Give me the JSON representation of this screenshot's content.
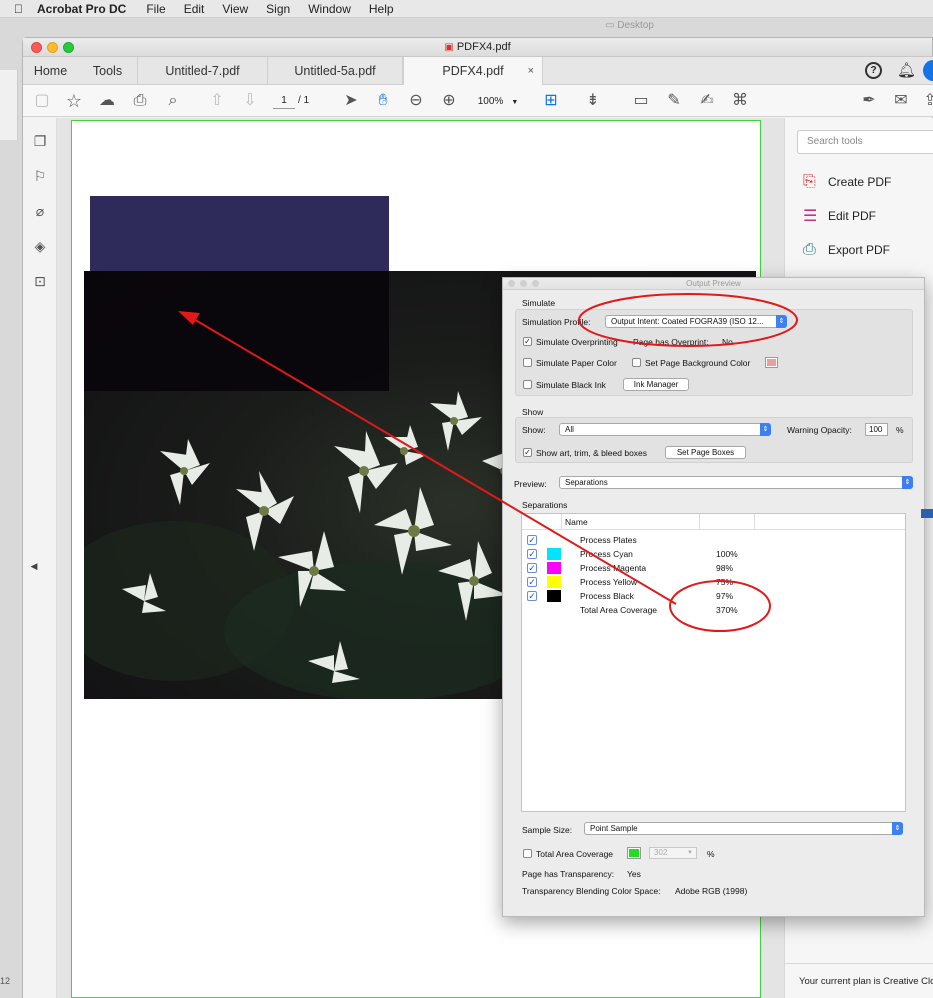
{
  "menubar": {
    "app": "Acrobat Pro DC",
    "items": [
      "File",
      "Edit",
      "View",
      "Sign",
      "Window",
      "Help"
    ],
    "desktop_label": "Desktop"
  },
  "window": {
    "title": "PDFX4.pdf",
    "tabs": [
      {
        "label": "Home"
      },
      {
        "label": "Tools"
      },
      {
        "label": "Untitled-7.pdf"
      },
      {
        "label": "Untitled-5a.pdf"
      },
      {
        "label": "PDFX4.pdf",
        "close": "×"
      }
    ]
  },
  "toolbar": {
    "page_current": "1",
    "page_total": "/ 1",
    "zoom": "100%"
  },
  "right_pane": {
    "search_placeholder": "Search tools",
    "tools": [
      {
        "label": "Create PDF",
        "icon": "create-pdf-icon",
        "color": "#d9322d"
      },
      {
        "label": "Edit PDF",
        "icon": "edit-pdf-icon",
        "color": "#c2338a"
      },
      {
        "label": "Export PDF",
        "icon": "export-pdf-icon",
        "color": "#2f7f8f"
      }
    ],
    "plan_text": "Your current plan is Creative Clou"
  },
  "output_preview": {
    "title": "Output Preview",
    "simulate": {
      "heading": "Simulate",
      "profile_label": "Simulation Profile:",
      "profile_value": "Output Intent: Coated FOGRA39 (ISO 12...",
      "simulate_overprinting": "Simulate Overprinting",
      "page_has_overprint_label": "Page has Overprint:",
      "page_has_overprint_value": "No",
      "simulate_paper_color": "Simulate Paper Color",
      "set_page_bg": "Set Page Background Color",
      "simulate_black_ink": "Simulate Black Ink",
      "ink_manager": "Ink Manager"
    },
    "show": {
      "heading": "Show",
      "show_label": "Show:",
      "show_value": "All",
      "warning_opacity_label": "Warning Opacity:",
      "warning_opacity_value": "100",
      "percent": "%",
      "show_boxes": "Show art, trim, & bleed boxes",
      "set_page_boxes": "Set Page Boxes"
    },
    "preview_label": "Preview:",
    "preview_value": "Separations",
    "separations": {
      "heading": "Separations",
      "column_name": "Name",
      "rows": [
        {
          "name": "Process Plates",
          "value": "",
          "swatch": "",
          "checked": true
        },
        {
          "name": "Process Cyan",
          "value": "100%",
          "swatch": "#00e5ff",
          "checked": true
        },
        {
          "name": "Process Magenta",
          "value": "98%",
          "swatch": "#ff00ff",
          "checked": true
        },
        {
          "name": "Process Yellow",
          "value": "75%",
          "swatch": "#ffff00",
          "checked": true
        },
        {
          "name": "Process Black",
          "value": "97%",
          "swatch": "#000000",
          "checked": true
        },
        {
          "name": "Total Area Coverage",
          "value": "370%",
          "swatch": "",
          "checked": false
        }
      ]
    },
    "sample_size_label": "Sample Size:",
    "sample_size_value": "Point Sample",
    "total_area_coverage": "Total Area Coverage",
    "tac_value": "302",
    "tac_percent": "%",
    "page_has_transparency_label": "Page has Transparency:",
    "page_has_transparency_value": "Yes",
    "blending_label": "Transparency Blending Color Space:",
    "blending_value": "Adobe RGB (1998)"
  },
  "colors": {
    "annotation_red": "#e0191b",
    "navy_rect": "#2e2a5a",
    "page_border": "#3ed63e",
    "tac_swatch": "#1ee01e",
    "page_bg_swatch": "#e8a0a0"
  },
  "misc": {
    "bottom_left_text": "12"
  }
}
